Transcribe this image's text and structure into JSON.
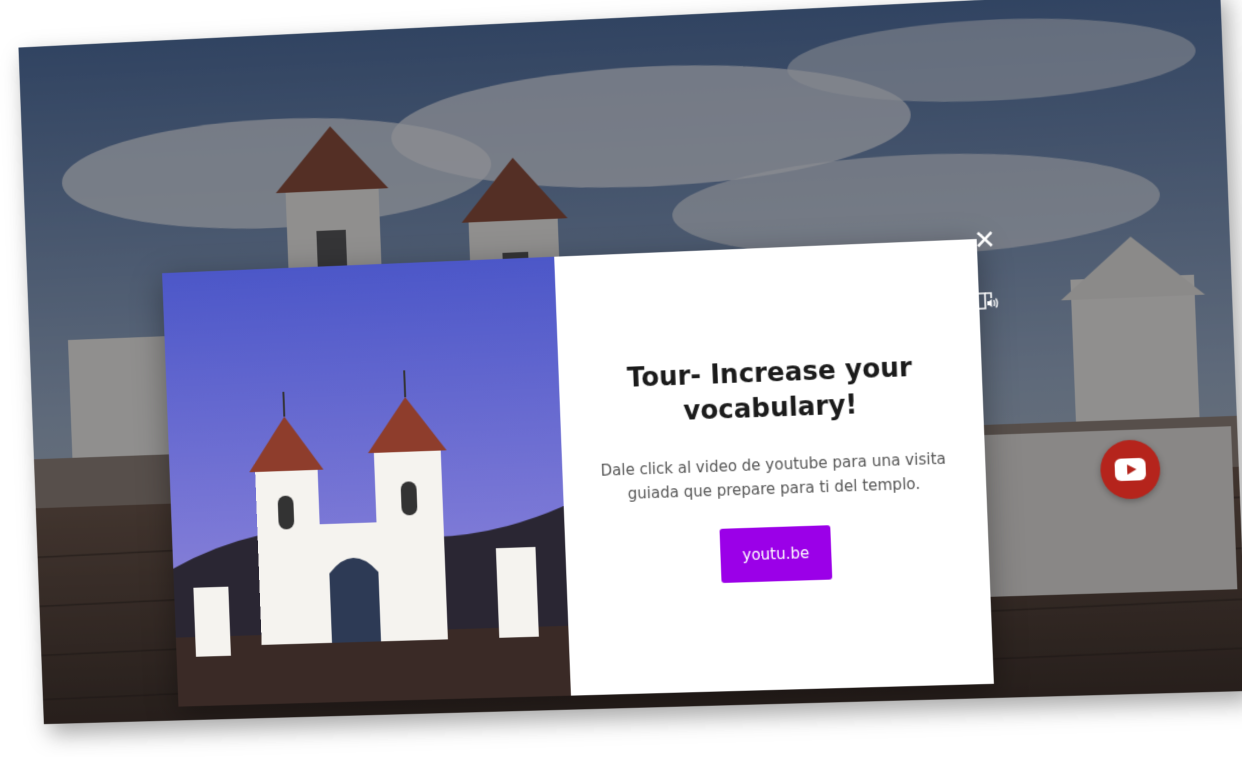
{
  "modal": {
    "title": "Tour- Increase your vocabulary!",
    "description": "Dale click al video de youtube para una visita guiada que prepare para ti del templo.",
    "button_label": "youtu.be",
    "accent_color": "#9b00e8"
  },
  "controls": {
    "close_icon": "close-icon",
    "audio_icon": "audio-book-icon",
    "video_icon": "youtube-play-icon",
    "video_icon_color": "#b5241c"
  }
}
